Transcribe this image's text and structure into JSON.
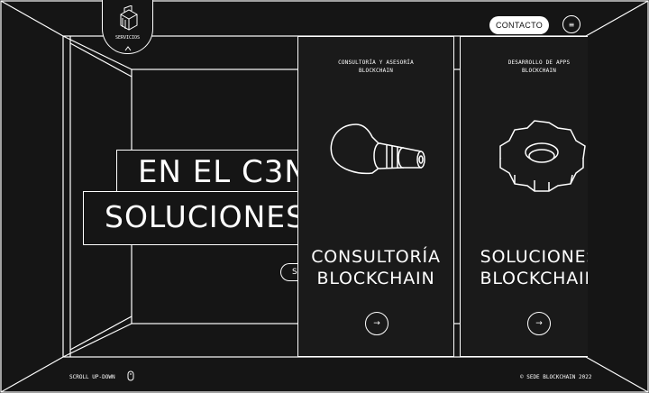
{
  "header": {
    "contact_label": "CONTACTO",
    "menu_icon": "menu-icon",
    "servicios_label": "SERVICIOS"
  },
  "hero": {
    "line1": "EN EL C3N",
    "line2": "SOLUCIONES",
    "pill_text": "S"
  },
  "cards": [
    {
      "kicker": "CONSULTORÍA Y ASESORÍA\nBLOCKCHAIN",
      "title": "CONSULTORÍA\nBLOCKCHAIN",
      "icon": "lightbulb-icon",
      "arrow": "→"
    },
    {
      "kicker": "DESARROLLO DE APPS\nBLOCKCHAIN",
      "title": "SOLUCIONES\nBLOCKCHAIN",
      "icon": "gear-icon",
      "arrow": "→"
    }
  ],
  "footer": {
    "scroll_label": "SCROLL UP-DOWN",
    "copyright": "© SEDE BLOCKCHAIN 2022"
  },
  "colors": {
    "background": "#151515",
    "line": "#ffffff",
    "button_bg": "#ffffff"
  }
}
